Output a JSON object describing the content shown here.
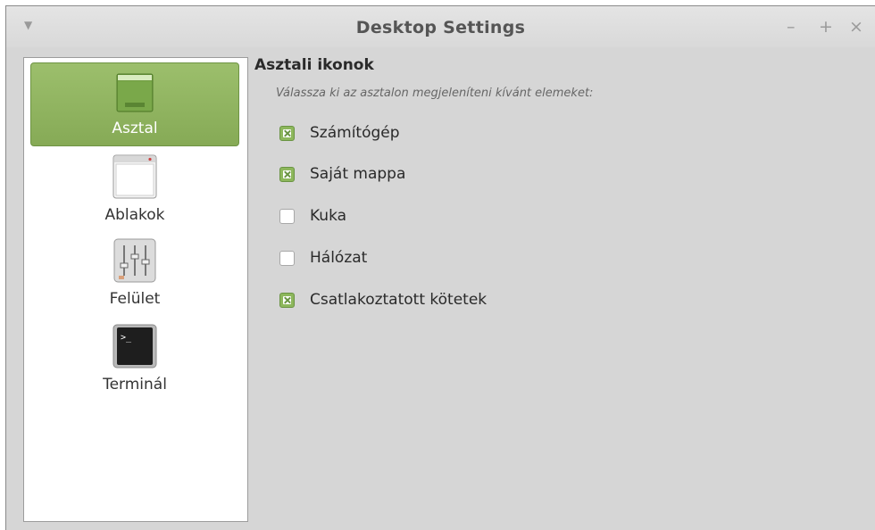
{
  "window": {
    "title": "Desktop Settings",
    "controls": {
      "minimize": "–",
      "maximize": "+",
      "close": "×"
    },
    "menu_arrow": "▼"
  },
  "sidebar": {
    "items": [
      {
        "label": "Asztal",
        "icon": "desktop-icon",
        "selected": true
      },
      {
        "label": "Ablakok",
        "icon": "window-icon",
        "selected": false
      },
      {
        "label": "Felület",
        "icon": "sliders-icon",
        "selected": false
      },
      {
        "label": "Terminál",
        "icon": "terminal-icon",
        "selected": false
      }
    ]
  },
  "main": {
    "section_title": "Asztali ikonok",
    "subtitle": "Válassza ki az asztalon megjeleníteni kívánt elemeket:",
    "options": [
      {
        "label": "Számítógép",
        "checked": true
      },
      {
        "label": "Saját mappa",
        "checked": true
      },
      {
        "label": "Kuka",
        "checked": false
      },
      {
        "label": "Hálózat",
        "checked": false
      },
      {
        "label": "Csatlakoztatott kötetek",
        "checked": true
      }
    ]
  },
  "colors": {
    "accent": "#8db75c",
    "window_bg": "#d6d6d6",
    "sidebar_bg": "#ffffff"
  }
}
